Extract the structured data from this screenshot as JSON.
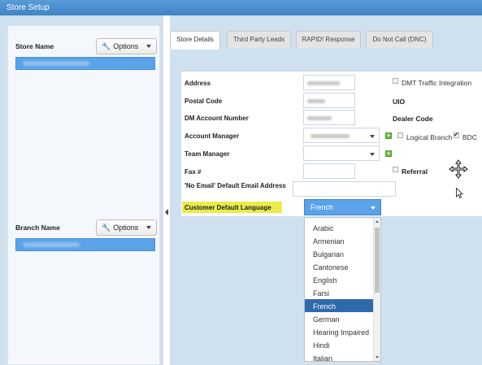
{
  "window": {
    "title": "Store Setup"
  },
  "left": {
    "store": {
      "label": "Store Name",
      "options_label": "Options"
    },
    "branch": {
      "label": "Branch Name",
      "options_label": "Options"
    }
  },
  "tabs": [
    {
      "label": "Store Details",
      "active": true
    },
    {
      "label": "Third Party Leads",
      "active": false
    },
    {
      "label": "RAPID! Response",
      "active": false
    },
    {
      "label": "Do Not Call (DNC)",
      "active": false
    }
  ],
  "form": {
    "address_label": "Address",
    "postal_label": "Postal Code",
    "dm_label": "DM Account Number",
    "account_mgr_label": "Account Manager",
    "team_mgr_label": "Team Manager",
    "fax_label": "Fax #",
    "no_email_label": "'No Email' Default Email Address",
    "lang_label": "Customer Default Language",
    "lang_value": "French"
  },
  "right_options": {
    "dmt_label": "DMT Traffic Integration",
    "dmt_checked": false,
    "uio_label": "UIO",
    "dealer_code_label": "Dealer Code",
    "logical_branch_label": "Logical Branch",
    "logical_branch_checked": false,
    "bdc_label": "BDC",
    "bdc_checked": true,
    "referral_label": "Referral",
    "referral_checked": false
  },
  "language_options": [
    "Arabic",
    "Armenian",
    "Bulgarian",
    "Cantonese",
    "English",
    "Farsi",
    "French",
    "German",
    "Hearing Impaired",
    "Hindi",
    "Italian"
  ],
  "selected_language": "French",
  "icons": {
    "wrench": "wrench-icon",
    "move": "move-cursor-icon",
    "pointer": "mouse-pointer-icon",
    "add": "green-plus-icon"
  },
  "colors": {
    "title_bar": "#3f84c6",
    "selection": "#2f6aab",
    "highlight": "#e9ec4a",
    "select_blue": "#5aa3e8"
  }
}
